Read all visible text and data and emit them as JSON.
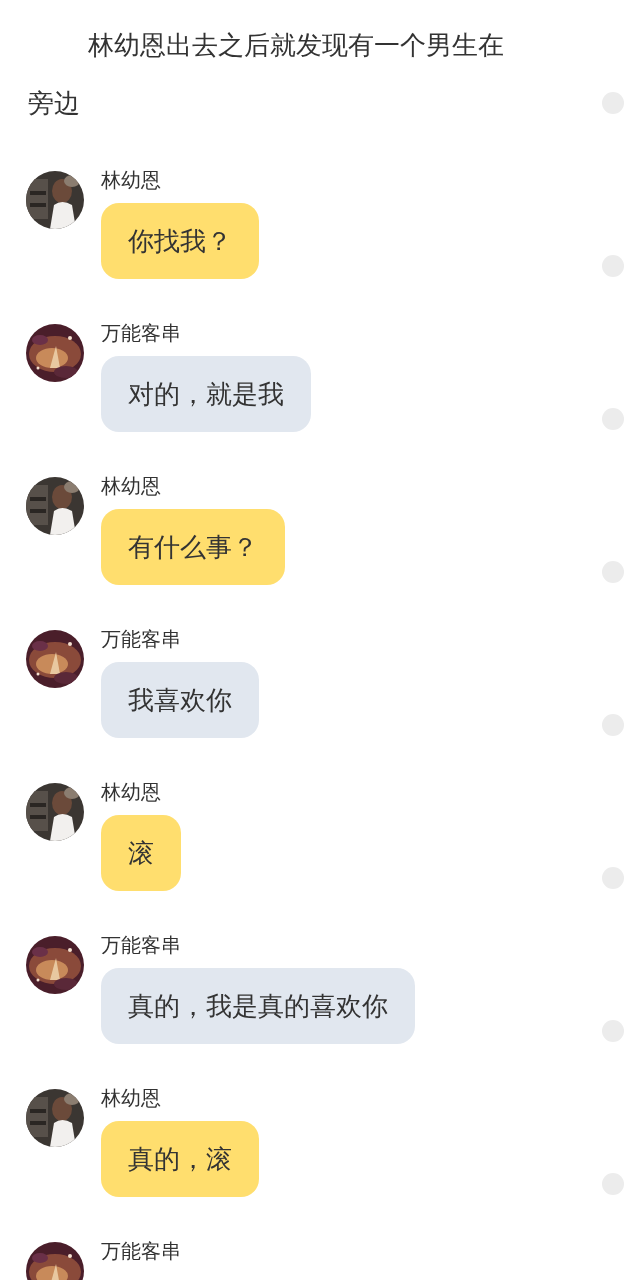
{
  "narration": "林幼恩出去之后就发现有一个男生在旁边",
  "messages": [
    {
      "speaker": "林幼恩",
      "kind": "heroine",
      "text": "你找我？"
    },
    {
      "speaker": "万能客串",
      "kind": "other",
      "text": "对的，就是我"
    },
    {
      "speaker": "林幼恩",
      "kind": "heroine",
      "text": "有什么事？"
    },
    {
      "speaker": "万能客串",
      "kind": "other",
      "text": "我喜欢你"
    },
    {
      "speaker": "林幼恩",
      "kind": "heroine",
      "text": "滚"
    },
    {
      "speaker": "万能客串",
      "kind": "other",
      "text": "真的，我是真的喜欢你"
    },
    {
      "speaker": "林幼恩",
      "kind": "heroine",
      "text": "真的，滚"
    },
    {
      "speaker": "万能客串",
      "kind": "other"
    }
  ]
}
